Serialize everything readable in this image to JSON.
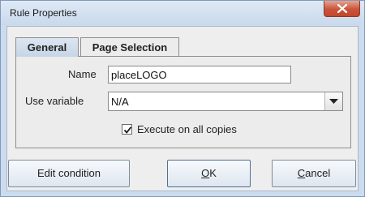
{
  "window": {
    "title": "Rule Properties",
    "close_icon": "close-x-icon"
  },
  "tabs": [
    {
      "label": "General",
      "active": true
    },
    {
      "label": "Page Selection",
      "active": false
    }
  ],
  "form": {
    "name_label": "Name",
    "name_value": "placeLOGO",
    "variable_label": "Use variable",
    "variable_value": "N/A",
    "execute_label": "Execute on all copies",
    "execute_checked": true
  },
  "buttons": {
    "edit_condition": "Edit condition",
    "ok_mnemonic": "O",
    "ok_rest": "K",
    "cancel_mnemonic": "C",
    "cancel_rest": "ancel"
  }
}
